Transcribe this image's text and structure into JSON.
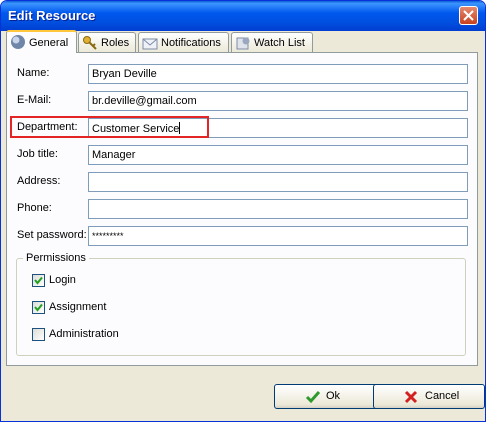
{
  "window": {
    "title": "Edit Resource"
  },
  "tabs": [
    {
      "label": "General",
      "icon": "globe-icon",
      "active": true
    },
    {
      "label": "Roles",
      "icon": "keys-icon",
      "active": false
    },
    {
      "label": "Notifications",
      "icon": "envelope-icon",
      "active": false
    },
    {
      "label": "Watch List",
      "icon": "watch-list-icon",
      "active": false
    }
  ],
  "form": {
    "name": {
      "label": "Name:",
      "value": "Bryan Deville"
    },
    "email": {
      "label": "E-Mail:",
      "value": "br.deville@gmail.com"
    },
    "department": {
      "label": "Department:",
      "value": "Customer Service"
    },
    "job_title": {
      "label": "Job title:",
      "value": "Manager"
    },
    "address": {
      "label": "Address:",
      "value": ""
    },
    "phone": {
      "label": "Phone:",
      "value": ""
    },
    "password": {
      "label": "Set password:",
      "value": "*********"
    }
  },
  "permissions": {
    "title": "Permissions",
    "items": [
      {
        "label": "Login",
        "checked": true
      },
      {
        "label": "Assignment",
        "checked": true
      },
      {
        "label": "Administration",
        "checked": false
      }
    ]
  },
  "buttons": {
    "ok_label": "Ok",
    "cancel_label": "Cancel"
  },
  "colors": {
    "titlebar": "#0058ee",
    "highlight": "#e32526",
    "ok_icon": "#2e9a2e",
    "cancel_icon": "#d42020"
  }
}
